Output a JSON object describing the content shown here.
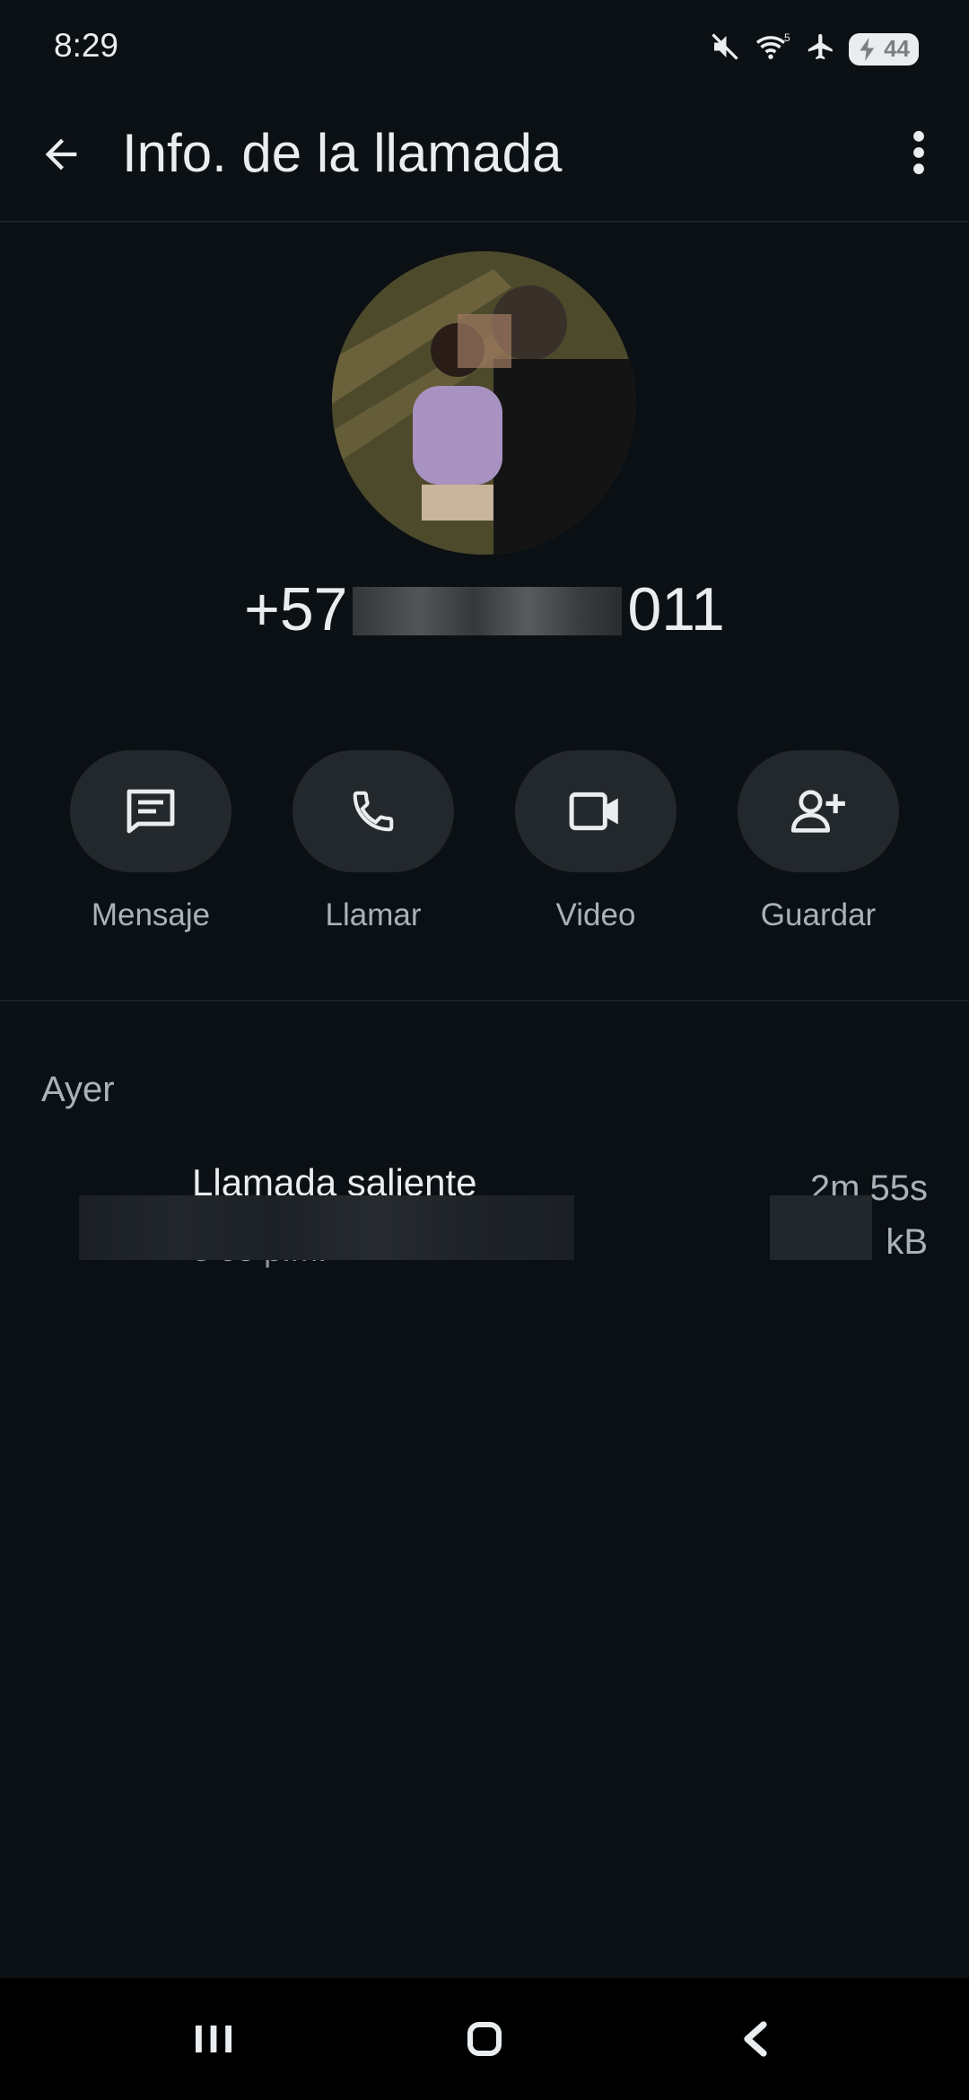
{
  "status_bar": {
    "time": "8:29",
    "battery_level": "44",
    "icons": [
      "mute-icon",
      "wifi-icon",
      "airplane-icon",
      "battery-charging-icon"
    ]
  },
  "app_bar": {
    "title": "Info. de la llamada",
    "back_icon": "arrow-back-icon",
    "menu_icon": "more-vert-icon"
  },
  "contact": {
    "phone_prefix": "+57",
    "phone_suffix": "011"
  },
  "actions": [
    {
      "label": "Mensaje",
      "icon": "message-icon"
    },
    {
      "label": "Llamar",
      "icon": "phone-icon"
    },
    {
      "label": "Video",
      "icon": "video-icon"
    },
    {
      "label": "Guardar",
      "icon": "add-person-icon"
    }
  ],
  "history": {
    "section": "Ayer",
    "calls": [
      {
        "type": "Llamada saliente",
        "time": "3 05 p.m.",
        "duration": "2m 55s",
        "size": "kB"
      }
    ]
  },
  "colors": {
    "background": "#0b1014",
    "action_button": "#23282c",
    "text_primary": "#e9edef",
    "text_secondary": "#aab2b7"
  }
}
